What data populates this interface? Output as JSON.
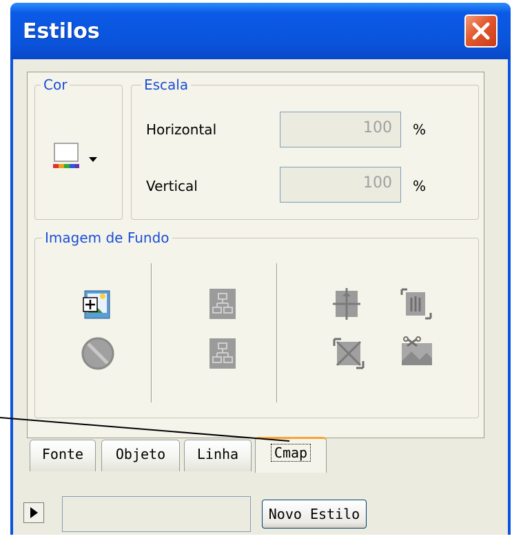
{
  "window": {
    "title": "Estilos"
  },
  "cor_group": {
    "label": "Cor"
  },
  "escala_group": {
    "label": "Escala",
    "horizontal_label": "Horizontal",
    "horizontal_value": "100",
    "vertical_label": "Vertical",
    "vertical_value": "100",
    "unit": "%"
  },
  "imagem_group": {
    "label": "Imagem de Fundo"
  },
  "tabs": [
    {
      "label": "Fonte"
    },
    {
      "label": "Objeto"
    },
    {
      "label": "Linha"
    },
    {
      "label": "Cmap"
    }
  ],
  "footer": {
    "new_style_label": "Novo Estilo"
  },
  "colors": {
    "title_bar": "#0a54e0",
    "group_label": "#1a4ed6",
    "active_tab_accent": "#f7a437"
  }
}
